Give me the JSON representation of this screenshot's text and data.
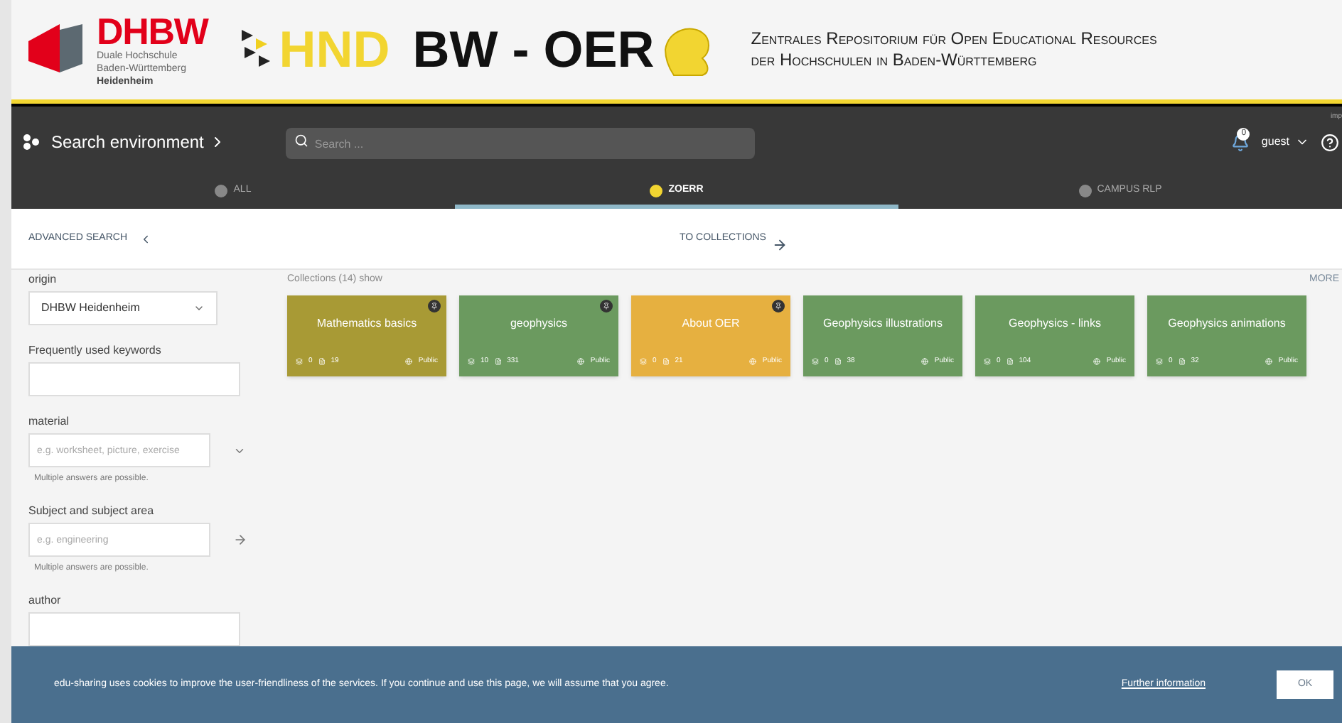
{
  "header": {
    "dhbw_logo": {
      "name": "DHBW",
      "lines": [
        "Duale Hochschule",
        "Baden-Württemberg"
      ],
      "location": "Heidenheim"
    },
    "oer_logo": {
      "prefix": "HND",
      "main": "BW - OER"
    },
    "tagline": [
      "Zentrales Repositorium für Open Educational Resources",
      "der Hochschulen in Baden-Württemberg"
    ]
  },
  "topbar": {
    "environment": "Search environment",
    "search_placeholder": "Search ...",
    "notifications": "0",
    "user": "guest",
    "corner_text": "imp"
  },
  "tabs": [
    {
      "label": "ALL",
      "selected": false
    },
    {
      "label": "ZOERR",
      "selected": true
    },
    {
      "label": "CAMPUS RLP",
      "selected": false
    }
  ],
  "subbar": {
    "advanced": "ADVANCED SEARCH",
    "collections": "TO COLLECTIONS"
  },
  "filters": [
    {
      "kind": "select",
      "label": "origin",
      "value": "DHBW Heidenheim"
    },
    {
      "kind": "text",
      "label": "Frequently used keywords"
    },
    {
      "kind": "dropdown",
      "label": "material",
      "placeholder": "e.g. worksheet, picture, exercise",
      "hint": "Multiple answers are possible."
    },
    {
      "kind": "tree",
      "label": "Subject and subject area",
      "placeholder": "e.g. engineering",
      "hint": "Multiple answers are possible."
    },
    {
      "kind": "text",
      "label": "author"
    }
  ],
  "collections": {
    "heading": "Collections (14) show",
    "more": "MORE",
    "items": [
      {
        "title": "Mathematics basics",
        "color": "#a89a35",
        "pinned": true,
        "subcollections": "0",
        "files": "19",
        "visibility": "Public"
      },
      {
        "title": "geophysics",
        "color": "#6b9a5f",
        "pinned": true,
        "subcollections": "10",
        "files": "331",
        "visibility": "Public"
      },
      {
        "title": "About OER",
        "color": "#e6b040",
        "pinned": true,
        "subcollections": "0",
        "files": "21",
        "visibility": "Public"
      },
      {
        "title": "Geophysics illustrations",
        "color": "#6b9a5f",
        "pinned": false,
        "subcollections": "0",
        "files": "38",
        "visibility": "Public"
      },
      {
        "title": "Geophysics - links",
        "color": "#6b9a5f",
        "pinned": false,
        "subcollections": "0",
        "files": "104",
        "visibility": "Public"
      },
      {
        "title": "Geophysics animations",
        "color": "#6b9a5f",
        "pinned": false,
        "subcollections": "0",
        "files": "32",
        "visibility": "Public"
      }
    ]
  },
  "cookie_banner": {
    "message": "edu-sharing uses cookies to improve the user-friendliness of the services. If you continue and use this page, we will assume that you agree.",
    "link": "Further information",
    "button": "OK"
  }
}
